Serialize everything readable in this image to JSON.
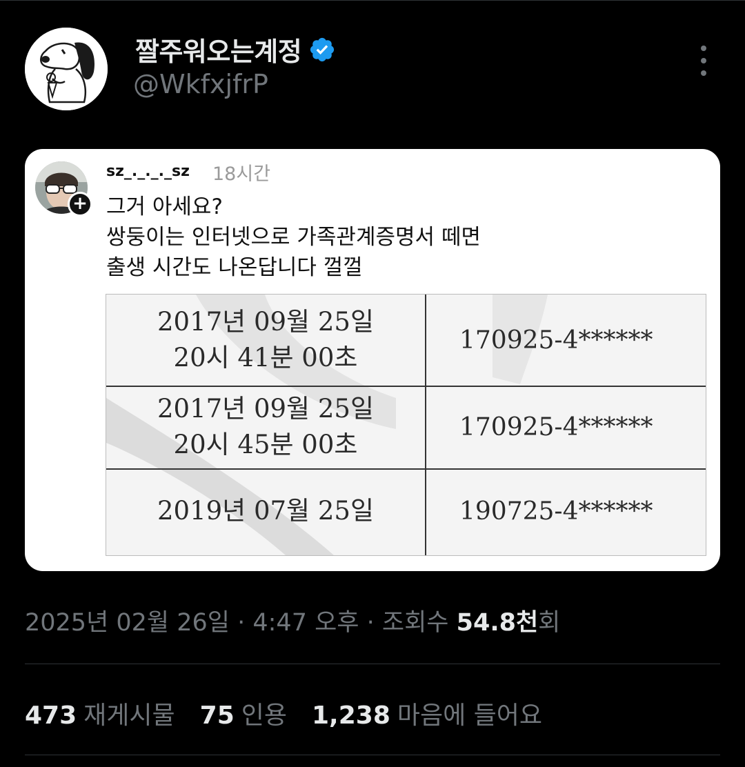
{
  "author": {
    "display_name": "짤주워오는계정",
    "handle": "@WkfxjfrP"
  },
  "quoted": {
    "username": "sz_._._._sz",
    "time": "18시간",
    "lines": [
      "그거 아세요?",
      "쌍둥이는 인터넷으로 가족관계증명서 떼면",
      "출생 시간도 나온답니다 껄껄"
    ],
    "table": [
      {
        "date": "2017년 09월 25일",
        "time": "20시 41분 00초",
        "id": "170925-4******"
      },
      {
        "date": "2017년 09월 25일",
        "time": "20시 45분 00초",
        "id": "170925-4******"
      },
      {
        "date": "2019년 07월 25일",
        "time": "",
        "id": "190725-4******"
      }
    ]
  },
  "meta": {
    "datetime": "2025년 02월 26일 · 4:47 오후 · 조회수 ",
    "views": "54.8천",
    "views_suffix": "회"
  },
  "stats": {
    "reposts_count": "473",
    "reposts_label": "재게시물",
    "quotes_count": "75",
    "quotes_label": "인용",
    "likes_count": "1,238",
    "likes_label": "마음에 들어요"
  },
  "colors": {
    "background": "#000000",
    "verified": "#1d9bf0",
    "muted": "#71767b",
    "text": "#e7e9ea"
  }
}
